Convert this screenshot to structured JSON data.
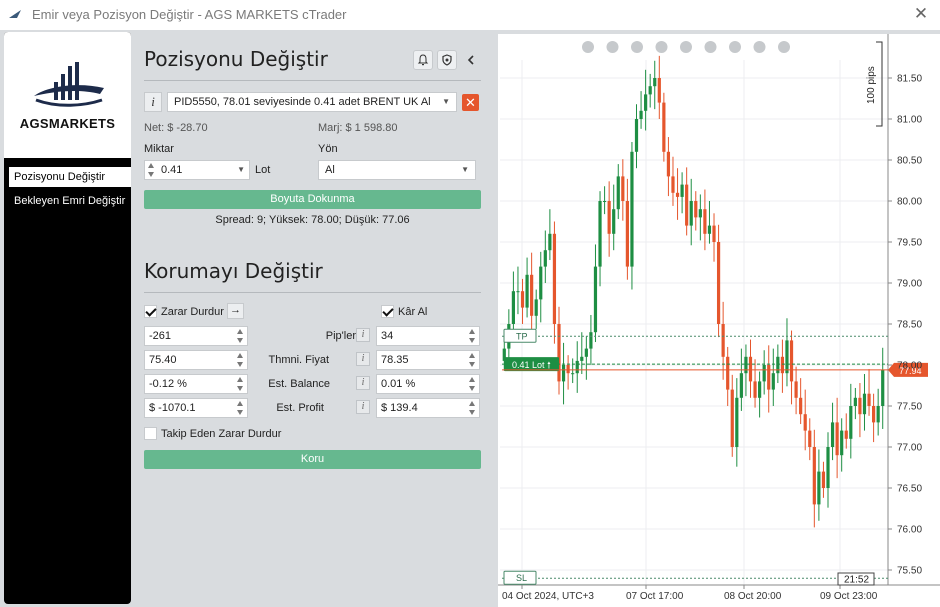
{
  "window": {
    "title": "Emir veya Pozisyon Değiştir - AGS MARKETS cTrader"
  },
  "sidebar": {
    "logo_text": "AGSMARKETS",
    "items": [
      {
        "label": "Pozisyonu Değiştir",
        "active": true
      },
      {
        "label": "Bekleyen Emri Değiştir",
        "active": false
      }
    ]
  },
  "modify_position": {
    "title": "Pozisyonu Değiştir",
    "position_select": "PID5550, 78.01 seviyesinde 0.41 adet BRENT UK Al",
    "net": "Net: $ -28.70",
    "margin": "Marj: $ 1 598.80",
    "amount_label": "Miktar",
    "amount_value": "0.41",
    "lot_label": "Lot",
    "direction_label": "Yön",
    "direction_value": "Al",
    "apply_button": "Boyuta Dokunma",
    "spread_text": "Spread: 9; Yüksek: 78.00; Düşük: 77.06"
  },
  "protection": {
    "title": "Korumayı Değiştir",
    "stop_loss_label": "Zarar Durdur",
    "stop_loss_checked": true,
    "take_profit_label": "Kâr Al",
    "take_profit_checked": true,
    "rows": [
      {
        "label": "Pip'ler",
        "sl": "-261",
        "tp": "34"
      },
      {
        "label": "Thmni. Fiyat",
        "sl": "75.40",
        "tp": "78.35"
      },
      {
        "label": "Est. Balance",
        "sl": "-0.12 %",
        "tp": "0.01 %"
      },
      {
        "label": "Est. Profit",
        "sl": "$ -1070.1",
        "tp": "$ 139.4"
      }
    ],
    "trailing_label": "Takip Eden Zarar Durdur",
    "trailing_checked": false,
    "protect_button": "Koru"
  },
  "chart": {
    "scale_label": "100 pips",
    "tp_label": "TP",
    "sl_label": "SL",
    "position_label": "0.41 Lot",
    "current_price": "77.94",
    "countdown": "21:52",
    "x_labels": [
      "04 Oct 2024, UTC+3",
      "07 Oct 17:00",
      "08 Oct 20:00",
      "09 Oct 23:00"
    ],
    "y_labels": [
      "81.50",
      "81.00",
      "80.50",
      "80.00",
      "79.50",
      "79.00",
      "78.50",
      "78.00",
      "77.50",
      "77.00",
      "76.50",
      "76.00",
      "75.50"
    ],
    "ylim": [
      75.4,
      81.95
    ],
    "position_price": 78.01,
    "tp_price": 78.35,
    "sl_price": 75.4,
    "bull_color": "#1e8e43",
    "bear_color": "#e5562d",
    "close_prices": [
      78.2,
      78.5,
      78.9,
      78.9,
      78.7,
      79.1,
      78.6,
      78.8,
      79.2,
      79.4,
      79.6,
      78.5,
      77.8,
      78.0,
      77.9,
      77.9,
      78.05,
      78.1,
      78.2,
      78.4,
      79.2,
      80.0,
      80.0,
      79.6,
      79.9,
      80.3,
      80.0,
      79.2,
      80.6,
      81.0,
      81.1,
      81.3,
      81.4,
      81.5,
      81.2,
      80.6,
      80.3,
      80.1,
      80.05,
      80.2,
      79.7,
      80.0,
      79.8,
      79.9,
      79.6,
      79.7,
      79.5,
      78.5,
      78.1,
      77.7,
      77.0,
      77.6,
      77.9,
      78.1,
      77.8,
      77.6,
      77.8,
      78.0,
      77.7,
      77.9,
      78.1,
      77.9,
      78.3,
      77.8,
      77.6,
      77.4,
      77.2,
      77.0,
      76.3,
      76.7,
      76.5,
      77.0,
      77.3,
      76.9,
      77.2,
      77.1,
      77.5,
      77.6,
      77.4,
      77.65,
      77.5,
      77.3,
      77.5,
      77.94
    ]
  }
}
